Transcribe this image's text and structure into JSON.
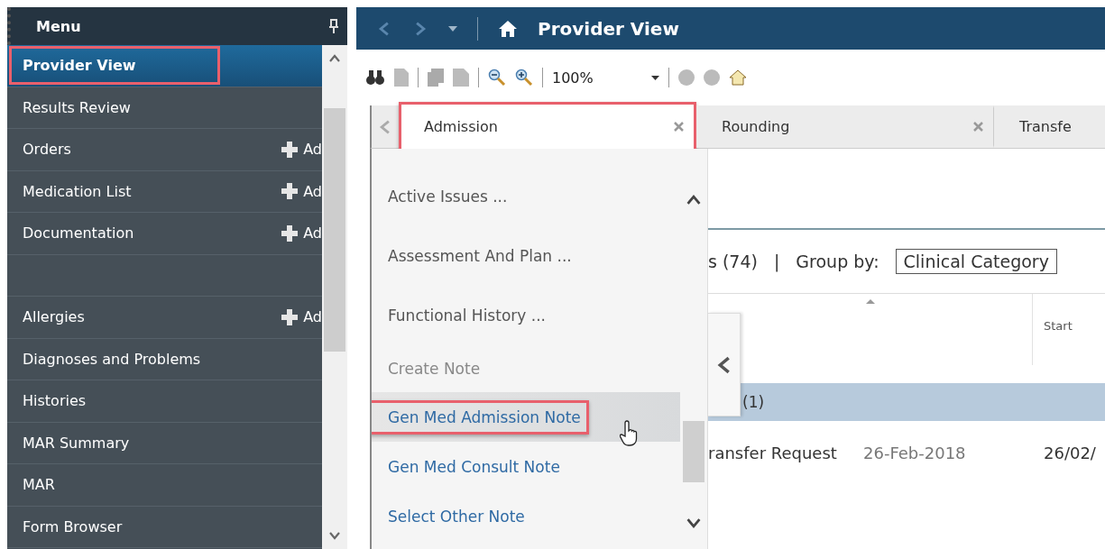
{
  "sidebar": {
    "title": "Menu",
    "items": [
      {
        "label": "Provider View",
        "selected": true,
        "highlighted": true,
        "gap_before": false
      },
      {
        "label": "Results Review",
        "selected": false,
        "highlighted": false,
        "gap_before": false
      },
      {
        "label": "Orders",
        "selected": false,
        "highlighted": false,
        "action": "Ad",
        "gap_before": false
      },
      {
        "label": "Medication List",
        "selected": false,
        "highlighted": false,
        "action": "Ad",
        "gap_before": false
      },
      {
        "label": "Documentation",
        "selected": false,
        "highlighted": false,
        "action": "Ad",
        "gap_before": false
      },
      {
        "label": "Allergies",
        "selected": false,
        "highlighted": false,
        "action": "Ad",
        "gap_before": true
      },
      {
        "label": "Diagnoses and Problems",
        "selected": false,
        "highlighted": false,
        "gap_before": false
      },
      {
        "label": "Histories",
        "selected": false,
        "highlighted": false,
        "gap_before": false
      },
      {
        "label": "MAR Summary",
        "selected": false,
        "highlighted": false,
        "gap_before": false
      },
      {
        "label": "MAR",
        "selected": false,
        "highlighted": false,
        "gap_before": false
      },
      {
        "label": "Form Browser",
        "selected": false,
        "highlighted": false,
        "gap_before": false
      }
    ]
  },
  "window": {
    "title": "Provider View"
  },
  "toolbar": {
    "zoom": "100%"
  },
  "tabs": [
    {
      "label": "Admission",
      "selected": true,
      "highlighted": true
    },
    {
      "label": "Rounding",
      "selected": false,
      "highlighted": false
    },
    {
      "label": "Transfe",
      "selected": false,
      "highlighted": false
    }
  ],
  "dropdown": {
    "items": [
      {
        "kind": "item",
        "label": "Active Issues ...",
        "hovered": false,
        "highlighted": false
      },
      {
        "kind": "item",
        "label": "Assessment And Plan ...",
        "hovered": false,
        "highlighted": false
      },
      {
        "kind": "item",
        "label": "Functional History ...",
        "hovered": false,
        "highlighted": false
      },
      {
        "kind": "heading",
        "label": "Create Note",
        "hovered": false,
        "highlighted": false
      },
      {
        "kind": "link",
        "label": "Gen Med Admission Note",
        "hovered": true,
        "highlighted": true
      },
      {
        "kind": "link",
        "label": "Gen Med Consult Note",
        "hovered": false,
        "highlighted": false
      },
      {
        "kind": "link",
        "label": "Select Other Note",
        "hovered": false,
        "highlighted": false
      }
    ]
  },
  "content": {
    "count": "s (74)",
    "separator": "|",
    "group_by_label": "Group by:",
    "group_by_value": "Clinical Category",
    "column_header": "Start",
    "group_count": "(1)",
    "row": {
      "title": "ransfer Request",
      "date": "26-Feb-2018",
      "start": "26/02/"
    }
  }
}
